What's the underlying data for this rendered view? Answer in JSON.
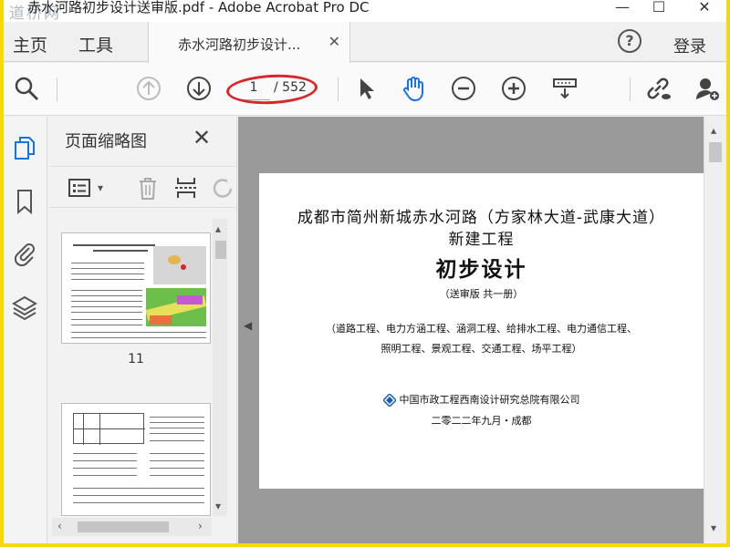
{
  "window": {
    "title": "赤水河路初步设计送审版.pdf - Adobe Acrobat Pro DC",
    "watermark": "道桥网",
    "minimize": "—",
    "maximize": "☐",
    "close": "✕"
  },
  "tabs": {
    "home": "主页",
    "tools": "工具",
    "document": "赤水河路初步设计...",
    "document_close": "✕",
    "help": "?",
    "login": "登录"
  },
  "toolbar": {
    "current_page": "1",
    "total_pages": "/ 552",
    "icons": [
      "search-zoom-icon",
      "page-up-icon",
      "page-down-icon",
      "select-cursor-icon",
      "hand-icon",
      "zoom-out-icon",
      "zoom-in-icon",
      "scroll-mode-icon",
      "share-link-icon",
      "add-user-icon"
    ]
  },
  "panel": {
    "title": "页面缩略图",
    "close": "✕",
    "thumbnails": [
      {
        "label": "11"
      },
      {
        "label": ""
      }
    ]
  },
  "document_page": {
    "line1": "成都市简州新城赤水河路（方家林大道-武康大道）",
    "line2": "新建工程",
    "line3": "初步设计",
    "line4": "（送审版   共一册）",
    "line5": "（道路工程、电力方涵工程、涵洞工程、给排水工程、电力通信工程、",
    "line6": "照明工程、景观工程、交通工程、场平工程）",
    "company": "中国市政工程西南设计研究总院有限公司",
    "date": "二零二二年九月・成都"
  },
  "colors": {
    "accent_blue": "#1473e6",
    "annotation_red": "#d8262b",
    "outer_border": "#f5d90a"
  }
}
